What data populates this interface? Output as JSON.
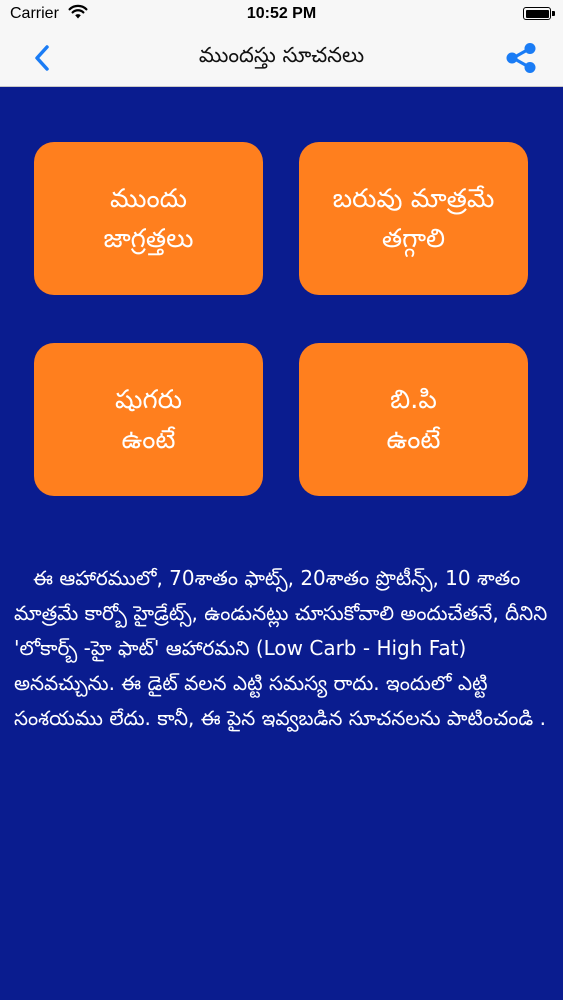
{
  "status_bar": {
    "carrier": "Carrier",
    "time": "10:52 PM"
  },
  "nav": {
    "title": "ముందస్తు సూచనలు"
  },
  "tiles": [
    {
      "line1": "ముందు",
      "line2": "జాగ్రత్తలు"
    },
    {
      "line1": "బరువు మాత్రమే",
      "line2": "తగ్గాలి"
    },
    {
      "line1": "షుగరు",
      "line2": "ఉంటే"
    },
    {
      "line1": "బి.పి",
      "line2": "ఉంటే"
    }
  ],
  "description": "   ఈ ఆహారములో, 70శాతం ఫాట్స్, 20శాతం ప్రొటీన్స్, 10 శాతం మాత్రమే కార్బో హైడ్రేట్స్, ఉండునట్లు చూసుకోవాలి అందుచేతనే, దీనిని 'లోకార్బ్ -హై ఫాట్' ఆహారమని (Low Carb - High Fat) అనవచ్చును. ఈ డైట్ వలన ఎట్టి సమస్య రాదు. ఇందులో ఎట్టి సంశయము లేదు. కానీ, ఈ పైన ఇవ్వబడిన సూచనలను పాటించండి .",
  "colors": {
    "background": "#0a1c8f",
    "tile": "#ff7f1e",
    "accent": "#1a7cf5"
  },
  "icons": {
    "back": "chevron-left-icon",
    "share": "share-icon",
    "wifi": "wifi-icon",
    "battery": "battery-icon"
  }
}
